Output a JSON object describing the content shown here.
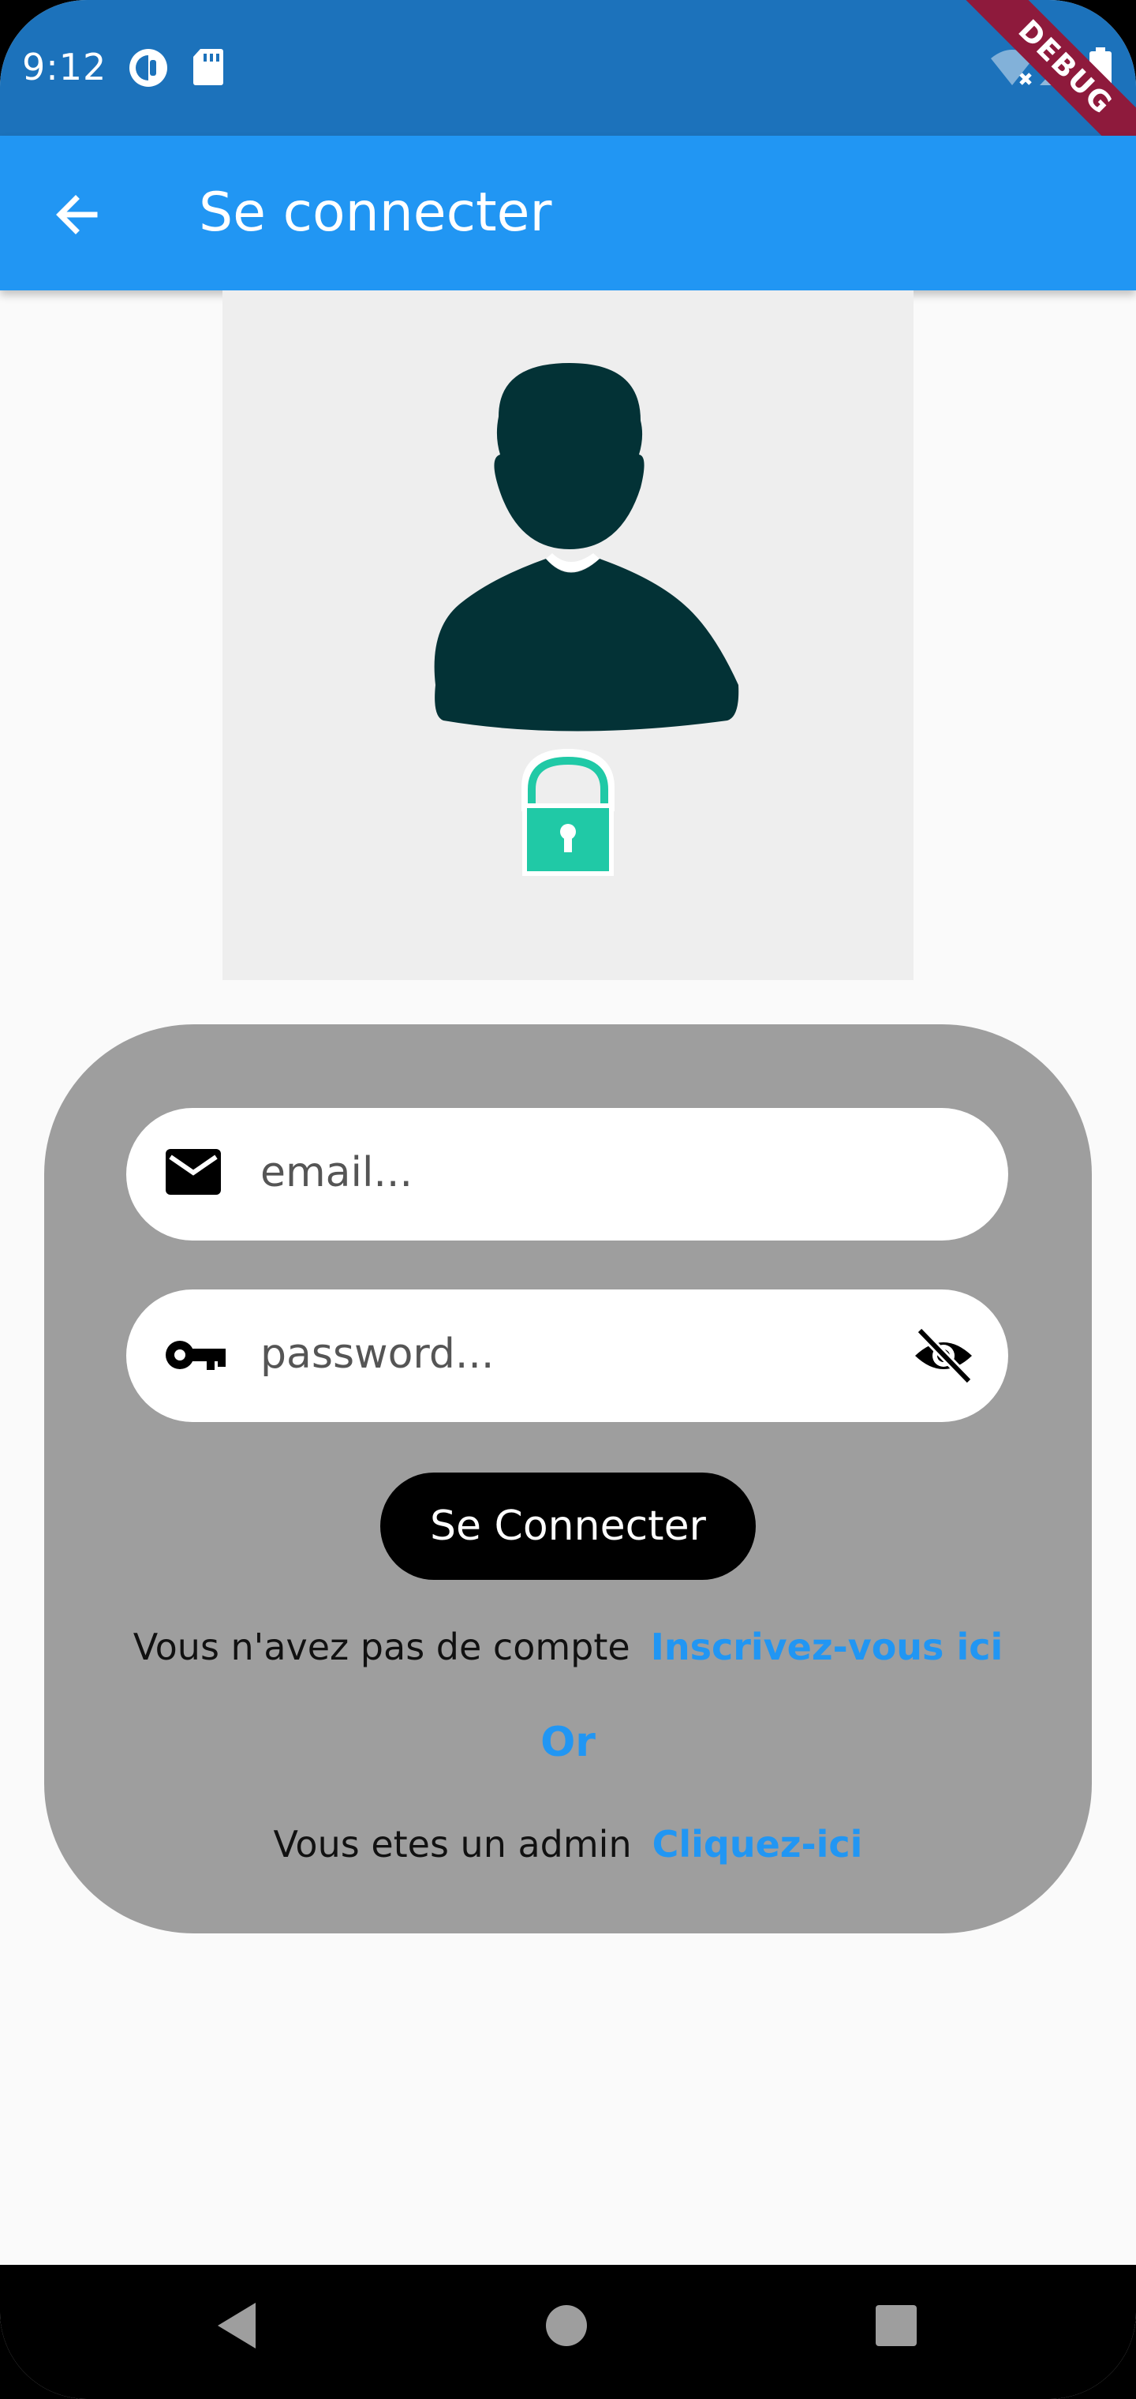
{
  "status_bar": {
    "time": "9:12",
    "debug_label": "DEBUG",
    "icons": [
      "vpn-icon",
      "sd-card-icon",
      "wifi-off-icon",
      "signal-icon",
      "battery-icon"
    ]
  },
  "app_bar": {
    "title": "Se connecter",
    "back_icon": "arrow-back-icon"
  },
  "avatar": {
    "icon": "user-lock-icon",
    "colors": {
      "silhouette": "#033236",
      "lock": "#20c9a6"
    }
  },
  "form": {
    "email_placeholder": "email...",
    "password_placeholder": "password...",
    "login_label": "Se Connecter",
    "signup_prompt": "Vous n'avez pas de compte",
    "signup_link": "Inscrivez-vous ici",
    "or_text": "Or",
    "admin_prompt": "Vous etes un admin",
    "admin_link": "Cliquez-ici"
  },
  "colors": {
    "status_bar": "#1c72bb",
    "app_bar": "#2196f3",
    "card": "#9e9e9e",
    "link": "#2196f3"
  },
  "nav_bar": {
    "buttons": [
      "back-triangle-icon",
      "home-circle-icon",
      "recents-square-icon"
    ]
  }
}
